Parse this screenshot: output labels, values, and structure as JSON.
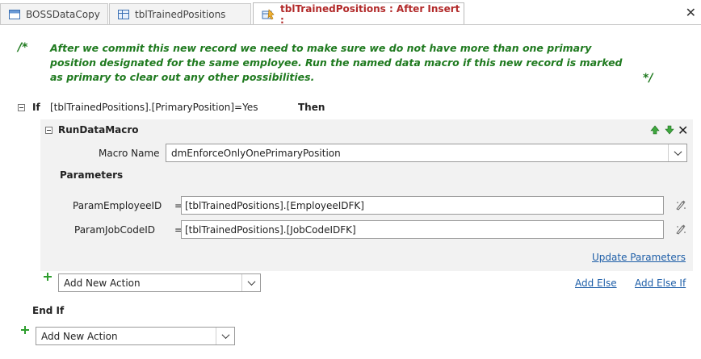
{
  "tabs": [
    {
      "label": "BOSSDataCopy",
      "icon": "database-icon"
    },
    {
      "label": "tblTrainedPositions",
      "icon": "table-icon"
    },
    {
      "label": "tblTrainedPositions : After Insert :",
      "icon": "data-macro-icon",
      "active": true
    }
  ],
  "comment": {
    "open": "/*",
    "text": "After we commit this new record we need to make sure we do not have more than one primary position designated for the same employee. Run the named data macro if this new record is marked as primary to clear out any other possibilities.",
    "close": "*/",
    "color": "#1f7a1f"
  },
  "if_block": {
    "keyword": "If",
    "condition": "[tblTrainedPositions].[PrimaryPosition]=Yes",
    "then": "Then",
    "end": "End If"
  },
  "action": {
    "name": "RunDataMacro",
    "macro_name_label": "Macro Name",
    "macro_name_value": "dmEnforceOnlyOnePrimaryPosition",
    "parameters_label": "Parameters",
    "params": [
      {
        "label": "ParamEmployeeID",
        "eq": "=",
        "value": "[tblTrainedPositions].[EmployeeIDFK]"
      },
      {
        "label": "ParamJobCodeID",
        "eq": "=",
        "value": "[tblTrainedPositions].[JobCodeIDFK]"
      }
    ],
    "update_parameters": "Update Parameters"
  },
  "add_new_action_inner": "Add New Action",
  "add_else": "Add Else",
  "add_else_if": "Add Else If",
  "add_new_action_outer": "Add New Action",
  "colors": {
    "accent_link": "#1f5fa8",
    "active_tab_text": "#b22a2a",
    "plus_green": "#2e9e2e"
  }
}
